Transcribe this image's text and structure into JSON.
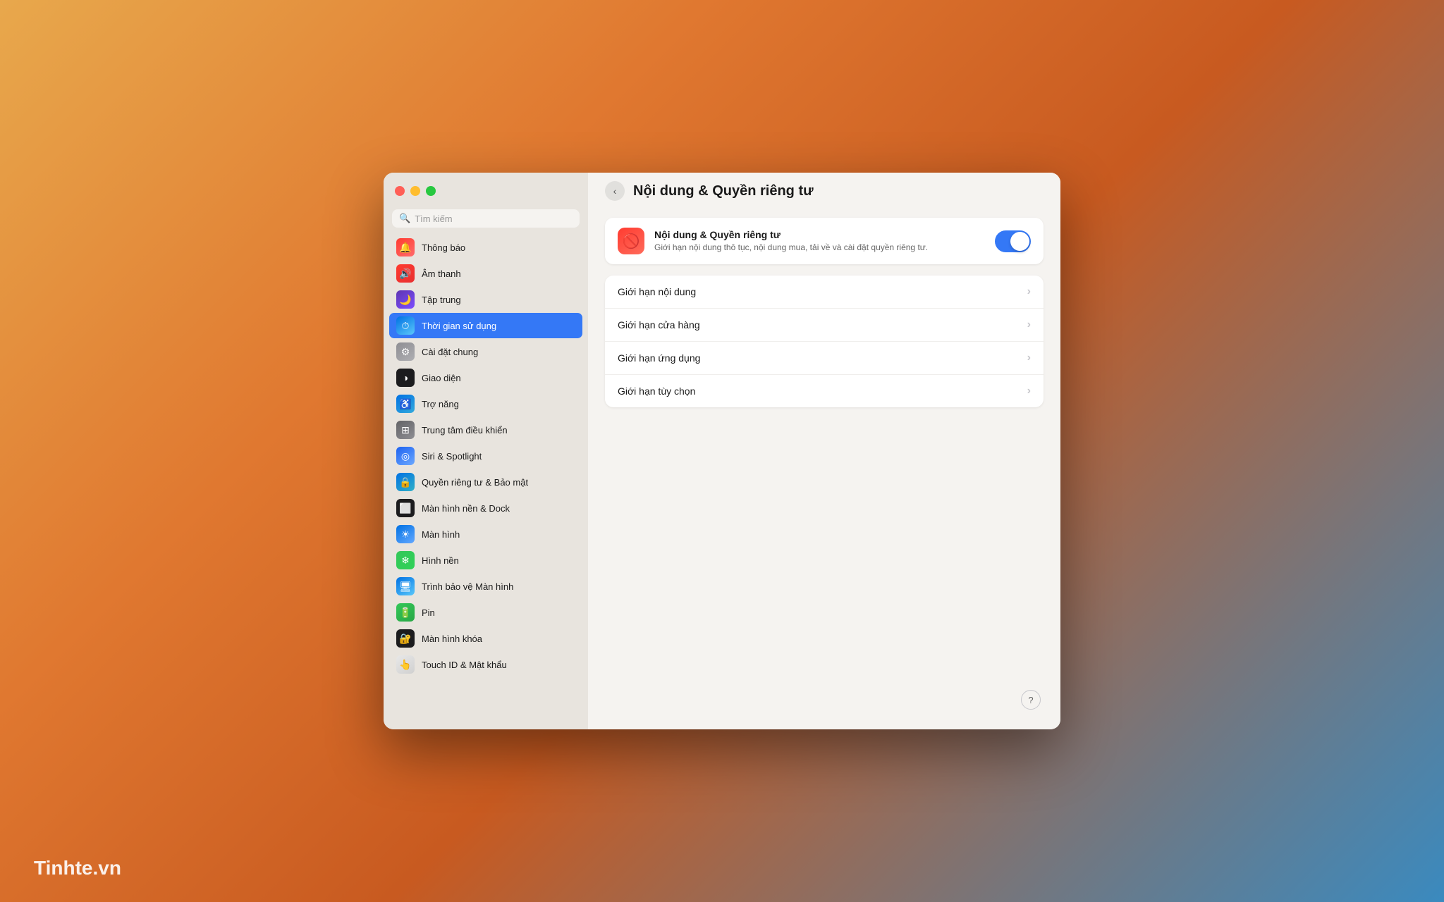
{
  "watermark": "Tinhte.vn",
  "window": {
    "title": "Nội dung & Quyền riêng tư"
  },
  "sidebar": {
    "search_placeholder": "Tìm kiếm",
    "items": [
      {
        "id": "notifications",
        "label": "Thông báo",
        "icon": "🔔",
        "icon_class": "icon-notifications"
      },
      {
        "id": "sound",
        "label": "Âm thanh",
        "icon": "🔊",
        "icon_class": "icon-sound"
      },
      {
        "id": "focus",
        "label": "Tập trung",
        "icon": "🌙",
        "icon_class": "icon-focus"
      },
      {
        "id": "screentime",
        "label": "Thời gian sử dụng",
        "icon": "⏱",
        "icon_class": "icon-screentime",
        "active": true
      },
      {
        "id": "general",
        "label": "Cài đặt chung",
        "icon": "⚙",
        "icon_class": "icon-general"
      },
      {
        "id": "appearance",
        "label": "Giao diện",
        "icon": "◑",
        "icon_class": "icon-appearance"
      },
      {
        "id": "accessibility",
        "label": "Trợ năng",
        "icon": "♿",
        "icon_class": "icon-accessibility"
      },
      {
        "id": "control",
        "label": "Trung tâm điều khiển",
        "icon": "⊞",
        "icon_class": "icon-control"
      },
      {
        "id": "siri",
        "label": "Siri & Spotlight",
        "icon": "◎",
        "icon_class": "icon-siri"
      },
      {
        "id": "privacy",
        "label": "Quyền riêng tư & Bảo mật",
        "icon": "🔒",
        "icon_class": "icon-privacy"
      },
      {
        "id": "wallpaper-dock",
        "label": "Màn hình nền & Dock",
        "icon": "⬜",
        "icon_class": "icon-wallpaper-dock"
      },
      {
        "id": "display",
        "label": "Màn hình",
        "icon": "☀",
        "icon_class": "icon-display"
      },
      {
        "id": "wallpaper",
        "label": "Hình nền",
        "icon": "❄",
        "icon_class": "icon-wallpaper"
      },
      {
        "id": "screensaver",
        "label": "Trình bảo vệ Màn hình",
        "icon": "🖥",
        "icon_class": "icon-screensaver"
      },
      {
        "id": "battery",
        "label": "Pin",
        "icon": "🔋",
        "icon_class": "icon-battery"
      },
      {
        "id": "lockscreen",
        "label": "Màn hình khóa",
        "icon": "🔐",
        "icon_class": "icon-lockscreen"
      },
      {
        "id": "touchid",
        "label": "Touch ID & Mật khẩu",
        "icon": "👆",
        "icon_class": "icon-touchid"
      }
    ]
  },
  "main": {
    "back_label": "‹",
    "title": "Nội dung & Quyền riêng tư",
    "top_card": {
      "title": "Nội dung & Quyền riêng tư",
      "subtitle": "Giới hạn nội dung thô tục, nội dung mua, tải về và cài đặt quyền riêng tư.",
      "toggle_on": true
    },
    "menu_rows": [
      {
        "label": "Giới hạn nội dung"
      },
      {
        "label": "Giới hạn cửa hàng"
      },
      {
        "label": "Giới hạn ứng dụng"
      },
      {
        "label": "Giới hạn tùy chọn"
      }
    ],
    "help_label": "?"
  }
}
